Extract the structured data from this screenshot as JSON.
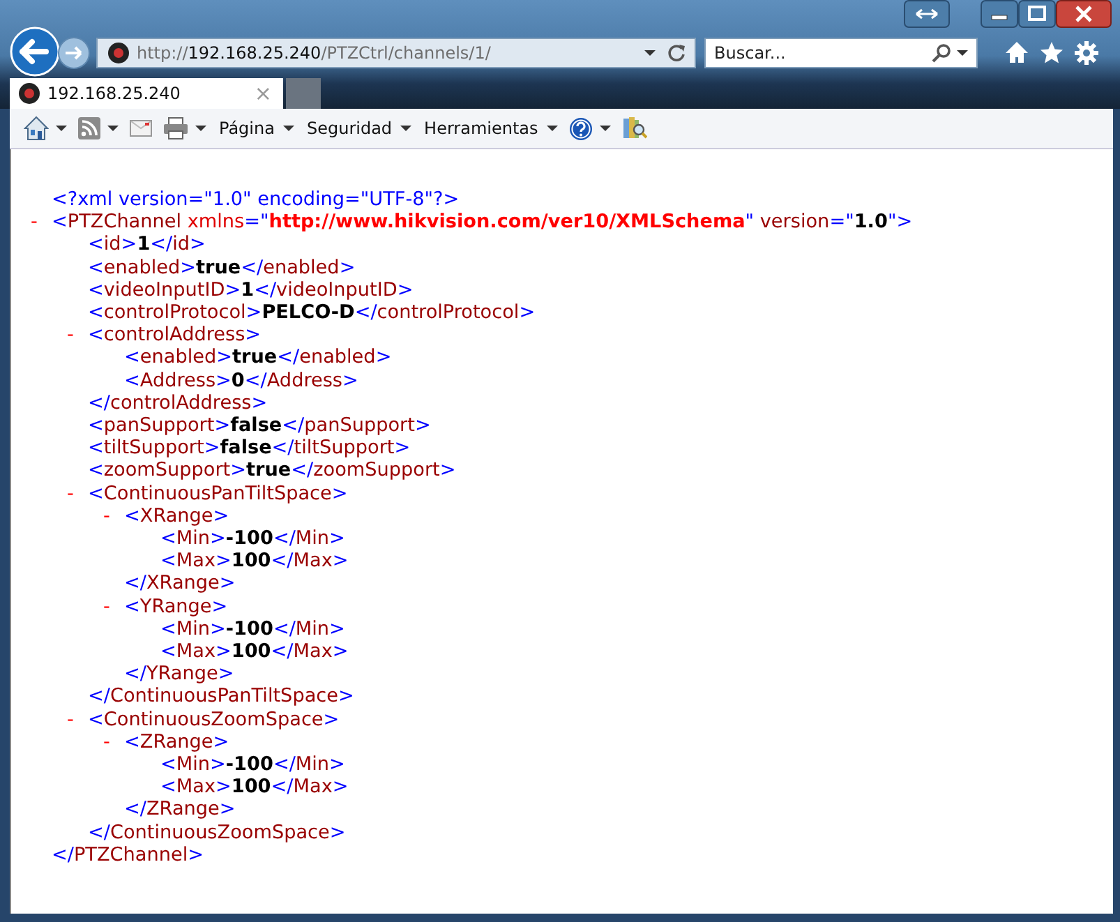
{
  "window": {
    "controls": [
      {
        "kind": "compat"
      },
      {
        "kind": "minimize"
      },
      {
        "kind": "maximize"
      },
      {
        "kind": "close"
      }
    ]
  },
  "address_bar": {
    "scheme": "http://",
    "host": "192.168.25.240",
    "path": "/PTZCtrl/channels/1/"
  },
  "search": {
    "placeholder": "Buscar..."
  },
  "tabs": [
    {
      "label": "192.168.25.240",
      "close": "×",
      "selected": true
    }
  ],
  "command_bar": [
    {
      "kind": "home",
      "dropdown": true
    },
    {
      "kind": "feed",
      "dropdown": true
    },
    {
      "kind": "mail",
      "dropdown": false
    },
    {
      "kind": "print",
      "dropdown": true
    },
    {
      "kind": "menu",
      "label": "Página",
      "dropdown": true
    },
    {
      "kind": "menu",
      "label": "Seguridad",
      "dropdown": true
    },
    {
      "kind": "menu",
      "label": "Herramientas",
      "dropdown": true
    },
    {
      "kind": "help",
      "dropdown": true
    },
    {
      "kind": "research",
      "dropdown": false
    }
  ],
  "document": {
    "declaration": "<?xml version=\"1.0\" encoding=\"UTF-8\"?>",
    "root": {
      "toggle": "-",
      "expanded": true,
      "open": [
        {
          "kind": "punct",
          "text": "<"
        },
        {
          "kind": "tag",
          "text": "PTZChannel"
        },
        {
          "kind": "ns",
          "text": " xmlns"
        },
        {
          "kind": "punct",
          "text": "=\""
        },
        {
          "kind": "ns_value",
          "text": "http://www.hikvision.com/ver10/XMLSchema"
        },
        {
          "kind": "punct",
          "text": "\""
        },
        {
          "kind": "tag",
          "text": " version"
        },
        {
          "kind": "punct",
          "text": "=\""
        },
        {
          "kind": "value",
          "text": "1.0"
        },
        {
          "kind": "punct",
          "text": "\">"
        }
      ],
      "close": [
        {
          "kind": "punct",
          "text": "</"
        },
        {
          "kind": "tag",
          "text": "PTZChannel"
        },
        {
          "kind": "punct",
          "text": ">"
        }
      ],
      "children": [
        {
          "open": [
            {
              "kind": "punct",
              "text": "<"
            },
            {
              "kind": "tag",
              "text": "id"
            },
            {
              "kind": "punct",
              "text": ">"
            }
          ],
          "value": "1",
          "close": [
            {
              "kind": "punct",
              "text": "</"
            },
            {
              "kind": "tag",
              "text": "id"
            },
            {
              "kind": "punct",
              "text": ">"
            }
          ]
        },
        {
          "open": [
            {
              "kind": "punct",
              "text": "<"
            },
            {
              "kind": "tag",
              "text": "enabled"
            },
            {
              "kind": "punct",
              "text": ">"
            }
          ],
          "value": "true",
          "close": [
            {
              "kind": "punct",
              "text": "</"
            },
            {
              "kind": "tag",
              "text": "enabled"
            },
            {
              "kind": "punct",
              "text": ">"
            }
          ]
        },
        {
          "open": [
            {
              "kind": "punct",
              "text": "<"
            },
            {
              "kind": "tag",
              "text": "videoInputID"
            },
            {
              "kind": "punct",
              "text": ">"
            }
          ],
          "value": "1",
          "close": [
            {
              "kind": "punct",
              "text": "</"
            },
            {
              "kind": "tag",
              "text": "videoInputID"
            },
            {
              "kind": "punct",
              "text": ">"
            }
          ]
        },
        {
          "open": [
            {
              "kind": "punct",
              "text": "<"
            },
            {
              "kind": "tag",
              "text": "controlProtocol"
            },
            {
              "kind": "punct",
              "text": ">"
            }
          ],
          "value": "PELCO-D",
          "close": [
            {
              "kind": "punct",
              "text": "</"
            },
            {
              "kind": "tag",
              "text": "controlProtocol"
            },
            {
              "kind": "punct",
              "text": ">"
            }
          ]
        },
        {
          "toggle": "-",
          "expanded": true,
          "open": [
            {
              "kind": "punct",
              "text": "<"
            },
            {
              "kind": "tag",
              "text": "controlAddress"
            },
            {
              "kind": "punct",
              "text": ">"
            }
          ],
          "close": [
            {
              "kind": "punct",
              "text": "</"
            },
            {
              "kind": "tag",
              "text": "controlAddress"
            },
            {
              "kind": "punct",
              "text": ">"
            }
          ],
          "children": [
            {
              "open": [
                {
                  "kind": "punct",
                  "text": "<"
                },
                {
                  "kind": "tag",
                  "text": "enabled"
                },
                {
                  "kind": "punct",
                  "text": ">"
                }
              ],
              "value": "true",
              "close": [
                {
                  "kind": "punct",
                  "text": "</"
                },
                {
                  "kind": "tag",
                  "text": "enabled"
                },
                {
                  "kind": "punct",
                  "text": ">"
                }
              ]
            },
            {
              "open": [
                {
                  "kind": "punct",
                  "text": "<"
                },
                {
                  "kind": "tag",
                  "text": "Address"
                },
                {
                  "kind": "punct",
                  "text": ">"
                }
              ],
              "value": "0",
              "close": [
                {
                  "kind": "punct",
                  "text": "</"
                },
                {
                  "kind": "tag",
                  "text": "Address"
                },
                {
                  "kind": "punct",
                  "text": ">"
                }
              ]
            }
          ]
        },
        {
          "open": [
            {
              "kind": "punct",
              "text": "<"
            },
            {
              "kind": "tag",
              "text": "panSupport"
            },
            {
              "kind": "punct",
              "text": ">"
            }
          ],
          "value": "false",
          "close": [
            {
              "kind": "punct",
              "text": "</"
            },
            {
              "kind": "tag",
              "text": "panSupport"
            },
            {
              "kind": "punct",
              "text": ">"
            }
          ]
        },
        {
          "open": [
            {
              "kind": "punct",
              "text": "<"
            },
            {
              "kind": "tag",
              "text": "tiltSupport"
            },
            {
              "kind": "punct",
              "text": ">"
            }
          ],
          "value": "false",
          "close": [
            {
              "kind": "punct",
              "text": "</"
            },
            {
              "kind": "tag",
              "text": "tiltSupport"
            },
            {
              "kind": "punct",
              "text": ">"
            }
          ]
        },
        {
          "open": [
            {
              "kind": "punct",
              "text": "<"
            },
            {
              "kind": "tag",
              "text": "zoomSupport"
            },
            {
              "kind": "punct",
              "text": ">"
            }
          ],
          "value": "true",
          "close": [
            {
              "kind": "punct",
              "text": "</"
            },
            {
              "kind": "tag",
              "text": "zoomSupport"
            },
            {
              "kind": "punct",
              "text": ">"
            }
          ]
        },
        {
          "toggle": "-",
          "expanded": true,
          "open": [
            {
              "kind": "punct",
              "text": "<"
            },
            {
              "kind": "tag",
              "text": "ContinuousPanTiltSpace"
            },
            {
              "kind": "punct",
              "text": ">"
            }
          ],
          "close": [
            {
              "kind": "punct",
              "text": "</"
            },
            {
              "kind": "tag",
              "text": "ContinuousPanTiltSpace"
            },
            {
              "kind": "punct",
              "text": ">"
            }
          ],
          "children": [
            {
              "toggle": "-",
              "expanded": true,
              "open": [
                {
                  "kind": "punct",
                  "text": "<"
                },
                {
                  "kind": "tag",
                  "text": "XRange"
                },
                {
                  "kind": "punct",
                  "text": ">"
                }
              ],
              "close": [
                {
                  "kind": "punct",
                  "text": "</"
                },
                {
                  "kind": "tag",
                  "text": "XRange"
                },
                {
                  "kind": "punct",
                  "text": ">"
                }
              ],
              "children": [
                {
                  "open": [
                    {
                      "kind": "punct",
                      "text": "<"
                    },
                    {
                      "kind": "tag",
                      "text": "Min"
                    },
                    {
                      "kind": "punct",
                      "text": ">"
                    }
                  ],
                  "value": "-100",
                  "close": [
                    {
                      "kind": "punct",
                      "text": "</"
                    },
                    {
                      "kind": "tag",
                      "text": "Min"
                    },
                    {
                      "kind": "punct",
                      "text": ">"
                    }
                  ]
                },
                {
                  "open": [
                    {
                      "kind": "punct",
                      "text": "<"
                    },
                    {
                      "kind": "tag",
                      "text": "Max"
                    },
                    {
                      "kind": "punct",
                      "text": ">"
                    }
                  ],
                  "value": "100",
                  "close": [
                    {
                      "kind": "punct",
                      "text": "</"
                    },
                    {
                      "kind": "tag",
                      "text": "Max"
                    },
                    {
                      "kind": "punct",
                      "text": ">"
                    }
                  ]
                }
              ]
            },
            {
              "toggle": "-",
              "expanded": true,
              "open": [
                {
                  "kind": "punct",
                  "text": "<"
                },
                {
                  "kind": "tag",
                  "text": "YRange"
                },
                {
                  "kind": "punct",
                  "text": ">"
                }
              ],
              "close": [
                {
                  "kind": "punct",
                  "text": "</"
                },
                {
                  "kind": "tag",
                  "text": "YRange"
                },
                {
                  "kind": "punct",
                  "text": ">"
                }
              ],
              "children": [
                {
                  "open": [
                    {
                      "kind": "punct",
                      "text": "<"
                    },
                    {
                      "kind": "tag",
                      "text": "Min"
                    },
                    {
                      "kind": "punct",
                      "text": ">"
                    }
                  ],
                  "value": "-100",
                  "close": [
                    {
                      "kind": "punct",
                      "text": "</"
                    },
                    {
                      "kind": "tag",
                      "text": "Min"
                    },
                    {
                      "kind": "punct",
                      "text": ">"
                    }
                  ]
                },
                {
                  "open": [
                    {
                      "kind": "punct",
                      "text": "<"
                    },
                    {
                      "kind": "tag",
                      "text": "Max"
                    },
                    {
                      "kind": "punct",
                      "text": ">"
                    }
                  ],
                  "value": "100",
                  "close": [
                    {
                      "kind": "punct",
                      "text": "</"
                    },
                    {
                      "kind": "tag",
                      "text": "Max"
                    },
                    {
                      "kind": "punct",
                      "text": ">"
                    }
                  ]
                }
              ]
            }
          ]
        },
        {
          "toggle": "-",
          "expanded": true,
          "open": [
            {
              "kind": "punct",
              "text": "<"
            },
            {
              "kind": "tag",
              "text": "ContinuousZoomSpace"
            },
            {
              "kind": "punct",
              "text": ">"
            }
          ],
          "close": [
            {
              "kind": "punct",
              "text": "</"
            },
            {
              "kind": "tag",
              "text": "ContinuousZoomSpace"
            },
            {
              "kind": "punct",
              "text": ">"
            }
          ],
          "children": [
            {
              "toggle": "-",
              "expanded": true,
              "open": [
                {
                  "kind": "punct",
                  "text": "<"
                },
                {
                  "kind": "tag",
                  "text": "ZRange"
                },
                {
                  "kind": "punct",
                  "text": ">"
                }
              ],
              "close": [
                {
                  "kind": "punct",
                  "text": "</"
                },
                {
                  "kind": "tag",
                  "text": "ZRange"
                },
                {
                  "kind": "punct",
                  "text": ">"
                }
              ],
              "children": [
                {
                  "open": [
                    {
                      "kind": "punct",
                      "text": "<"
                    },
                    {
                      "kind": "tag",
                      "text": "Min"
                    },
                    {
                      "kind": "punct",
                      "text": ">"
                    }
                  ],
                  "value": "-100",
                  "close": [
                    {
                      "kind": "punct",
                      "text": "</"
                    },
                    {
                      "kind": "tag",
                      "text": "Min"
                    },
                    {
                      "kind": "punct",
                      "text": ">"
                    }
                  ]
                },
                {
                  "open": [
                    {
                      "kind": "punct",
                      "text": "<"
                    },
                    {
                      "kind": "tag",
                      "text": "Max"
                    },
                    {
                      "kind": "punct",
                      "text": ">"
                    }
                  ],
                  "value": "100",
                  "close": [
                    {
                      "kind": "punct",
                      "text": "</"
                    },
                    {
                      "kind": "tag",
                      "text": "Max"
                    },
                    {
                      "kind": "punct",
                      "text": ">"
                    }
                  ]
                }
              ]
            }
          ]
        }
      ]
    }
  }
}
